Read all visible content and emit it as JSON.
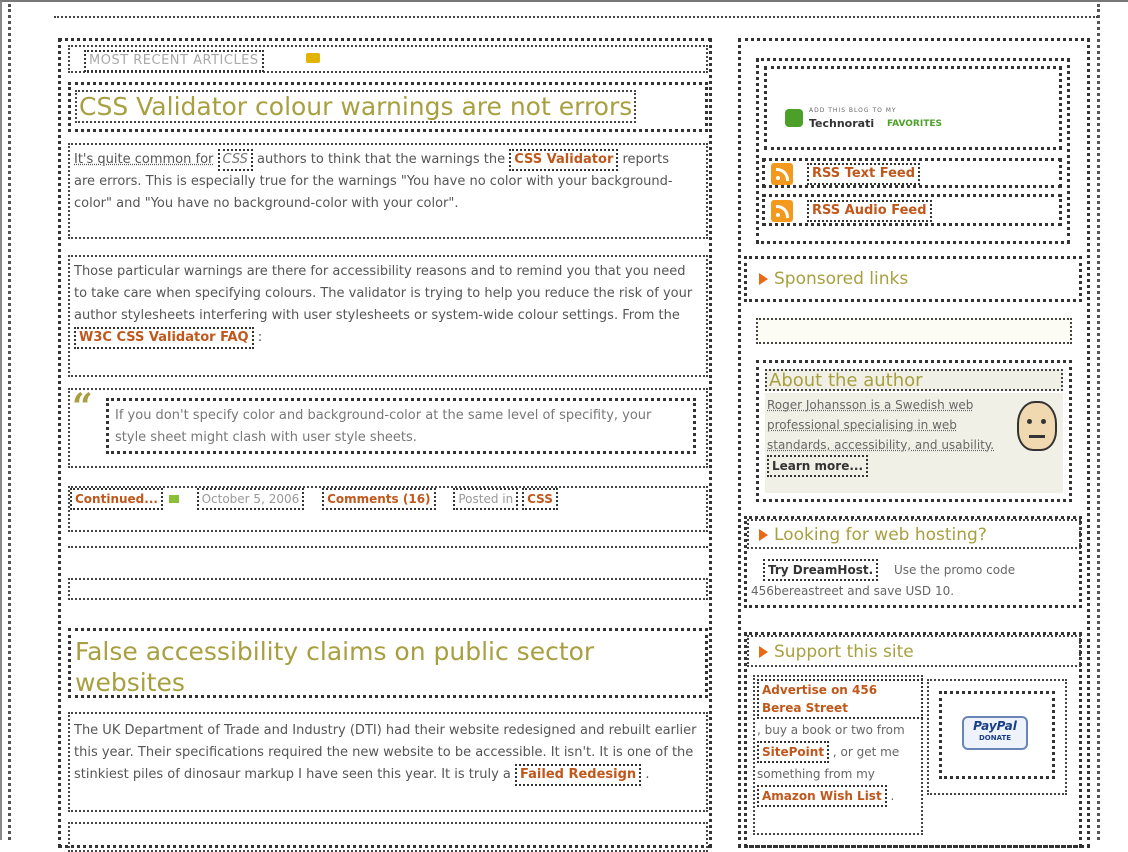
{
  "main": {
    "section_label": "MOST RECENT ARTICLES",
    "article1": {
      "title": "CSS Validator colour warnings are not errors",
      "p1_a": "It's quite common for",
      "p1_abbr": "CSS",
      "p1_b": "authors to think that the warnings the",
      "p1_link": "CSS Validator",
      "p1_c": "reports are errors. This is especially true for the warnings \"You have no color with your background-color\" and \"You have no background-color with your color\".",
      "p2": "Those particular warnings are there for accessibility reasons and to remind you that you need to take care when specifying colours. The validator is trying to help you reduce the risk of your author stylesheets interfering with user stylesheets or system-wide colour settings. From the",
      "p2_link": "W3C CSS Validator FAQ",
      "p2_end": ":",
      "quote": "If you don't specify color and background-color at the same level of specifity, your style sheet might clash with user style sheets.",
      "continued": "Continued...",
      "date": "October 5, 2006",
      "comments": "Comments (16)",
      "posted_in": "Posted in",
      "category": "CSS"
    },
    "article2": {
      "title": "False accessibility claims on public sector websites",
      "p1": "The UK Department of Trade and Industry (DTI) had their website redesigned and rebuilt earlier this year. Their specifications required the new website to be accessible. It isn't. It is one of the stinkiest piles of dinosaur markup I have seen this year. It is truly a",
      "p1_link": "Failed Redesign",
      "p1_end": "."
    }
  },
  "sidebar": {
    "technorati_small": "ADD THIS BLOG TO MY",
    "technorati_name": "Technorati",
    "technorati_fav": "FAVORITES",
    "rss_text": "RSS Text Feed",
    "rss_audio": "RSS Audio Feed",
    "sponsored": "Sponsored links",
    "about_title": "About the author",
    "about_text": "Roger Johansson is a Swedish web professional specialising in web standards, accessibility, and usability.",
    "learn_more": "Learn more...",
    "hosting_title": "Looking for web hosting?",
    "hosting_link": "Try DreamHost.",
    "hosting_text": "Use the promo code 456bereastreet and save USD 10.",
    "support_title": "Support this site",
    "support_link1": "Advertise on 456 Berea Street",
    "support_t1": ", buy a book or two from",
    "support_link2": "SitePoint",
    "support_t2": ", or get me something from my",
    "support_link3": "Amazon Wish List",
    "support_t3": ".",
    "paypal": "PayPal",
    "donate": "DONATE"
  },
  "colors": {
    "heading": "#a8a040",
    "link": "#c0581c",
    "accent": "#e96a14"
  }
}
